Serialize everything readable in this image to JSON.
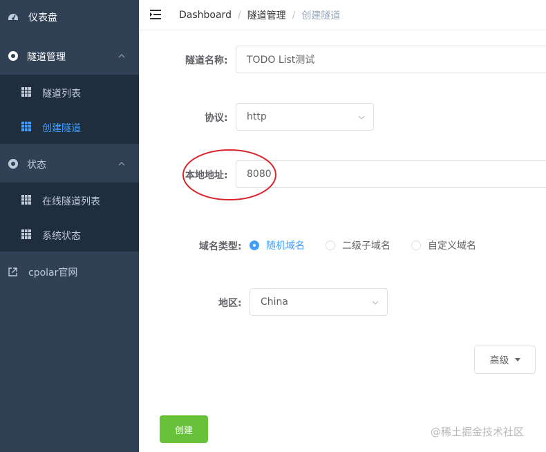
{
  "sidebar": {
    "dashboard": "仪表盘",
    "tunnel_mgmt": "隧道管理",
    "tunnel_list": "隧道列表",
    "create_tunnel": "创建隧道",
    "status": "状态",
    "online_tunnels": "在线隧道列表",
    "system_status": "系统状态",
    "cpolar_site": "cpolar官网"
  },
  "breadcrumb": {
    "root": "Dashboard",
    "sep": "/",
    "section": "隧道管理",
    "current": "创建隧道"
  },
  "form": {
    "name_label": "隧道名称:",
    "name_value": "TODO List测试",
    "protocol_label": "协议:",
    "protocol_value": "http",
    "local_label": "本地地址:",
    "local_value": "8080",
    "domain_type_label": "域名类型:",
    "domain_options": [
      "随机域名",
      "二级子域名",
      "自定义域名"
    ],
    "domain_selected": "随机域名",
    "region_label": "地区:",
    "region_value": "China",
    "advanced_label": "高级",
    "create_label": "创建"
  },
  "watermark": "@稀土掘金技术社区",
  "colors": {
    "sidebar_bg": "#304156",
    "submenu_bg": "#1f2d3d",
    "accent": "#409eff",
    "success": "#67c23a",
    "annotation": "#d9262c"
  }
}
